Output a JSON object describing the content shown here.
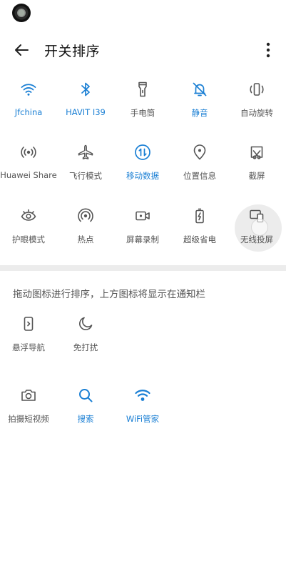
{
  "header": {
    "title": "开关排序",
    "back_icon": "arrow-left-icon",
    "more_icon": "more-vertical-icon"
  },
  "colors": {
    "accent": "#1a7fd4",
    "icon_gray": "#555555"
  },
  "active_tiles": [
    {
      "label": "Jfchina",
      "icon": "wifi-icon"
    },
    {
      "label": "HAVIT I39",
      "icon": "bluetooth-icon"
    },
    {
      "label": "手电筒",
      "icon": "flashlight-icon"
    },
    {
      "label": "静音",
      "icon": "bell-off-icon"
    },
    {
      "label": "自动旋转",
      "icon": "auto-rotate-icon"
    },
    {
      "label": "Huawei Share",
      "icon": "huawei-share-icon"
    },
    {
      "label": "飞行模式",
      "icon": "airplane-icon"
    },
    {
      "label": "移动数据",
      "icon": "mobile-data-icon"
    },
    {
      "label": "位置信息",
      "icon": "location-icon"
    },
    {
      "label": "截屏",
      "icon": "screenshot-icon"
    },
    {
      "label": "护眼模式",
      "icon": "eye-icon"
    },
    {
      "label": "热点",
      "icon": "hotspot-icon"
    },
    {
      "label": "屏幕录制",
      "icon": "screen-record-icon"
    },
    {
      "label": "超级省电",
      "icon": "battery-saver-icon"
    },
    {
      "label": "无线投屏",
      "icon": "wireless-projection-icon"
    }
  ],
  "hint": "拖动图标进行排序，上方图标将显示在通知栏",
  "inactive_tiles": [
    {
      "label": "悬浮导航",
      "icon": "floating-nav-icon"
    },
    {
      "label": "免打扰",
      "icon": "moon-icon"
    },
    {
      "label": "拍摄短视频",
      "icon": "camera-icon"
    },
    {
      "label": "搜索",
      "icon": "search-icon"
    },
    {
      "label": "WiFi管家",
      "icon": "wifi-manager-icon"
    }
  ]
}
